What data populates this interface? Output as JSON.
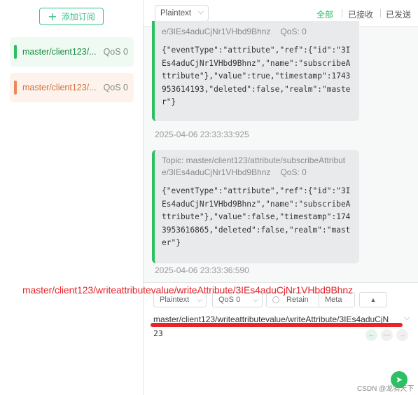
{
  "sidebar": {
    "add_label": "添加订阅",
    "subscriptions": [
      {
        "topic": "master/client123/...",
        "qos": "QoS 0",
        "color": "#2dbf63"
      },
      {
        "topic": "master/client123/...",
        "qos": "QoS 0",
        "color": "#e9895a"
      }
    ]
  },
  "toolbar": {
    "format": "Plaintext",
    "filters": [
      {
        "label": "全部",
        "active": true
      },
      {
        "label": "已接收",
        "active": false
      },
      {
        "label": "已发送",
        "active": false
      }
    ]
  },
  "messages": [
    {
      "topic_line2": "e/3IEs4aduCjNr1VHbd9Bhnz",
      "qos": "QoS: 0",
      "payload": "{\"eventType\":\"attribute\",\"ref\":{\"id\":\"3IEs4aduCjNr1VHbd9Bhnz\",\"name\":\"subscribeAttribute\"},\"value\":true,\"timestamp\":1743953614193,\"deleted\":false,\"realm\":\"master\"}",
      "time": "2025-04-06 23:33:33:925"
    },
    {
      "topic_line1": "Topic: master/client123/attribute/subscribeAttribut",
      "topic_line2": "e/3IEs4aduCjNr1VHbd9Bhnz",
      "qos": "QoS: 0",
      "payload": "{\"eventType\":\"attribute\",\"ref\":{\"id\":\"3IEs4aduCjNr1VHbd9Bhnz\",\"name\":\"subscribeAttribute\"},\"value\":false,\"timestamp\":1743953616865,\"deleted\":false,\"realm\":\"master\"}",
      "time": "2025-04-06 23:33:36:590"
    }
  ],
  "annotation": "master/client123/writeattributevalue/writeAttribute/3IEs4aduCjNr1VHbd9Bhnz",
  "composer": {
    "format": "Plaintext",
    "qos": "QoS 0",
    "retain": "Retain",
    "meta": "Meta",
    "topic_value": "master/client123/writeattributevalue/writeAttribute/3IEs4aduCjN",
    "payload_value": "23"
  },
  "watermark": "CSDN @龙骑天下",
  "colors": {
    "accent": "#2dbf63",
    "annotation": "#e8242a"
  }
}
